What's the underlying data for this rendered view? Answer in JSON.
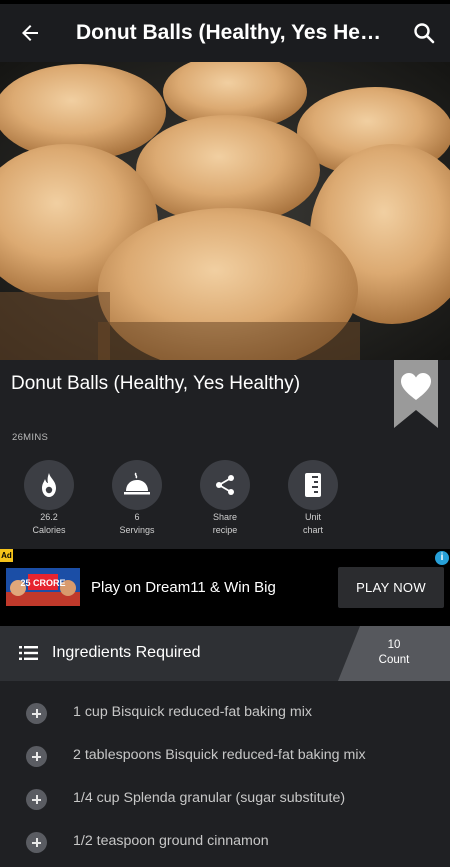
{
  "appbar": {
    "title": "Donut Balls (Healthy, Yes Healt...",
    "back_icon": "arrow-left-icon",
    "search_icon": "search-icon"
  },
  "recipe": {
    "title": "Donut Balls (Healthy, Yes Healthy)",
    "time": "26MINS",
    "favorite_icon": "heart-icon"
  },
  "stats": [
    {
      "icon": "fire-icon",
      "value": "26.2",
      "label": "Calories"
    },
    {
      "icon": "serving-dish-icon",
      "value": "6",
      "label": "Servings"
    },
    {
      "icon": "share-icon",
      "value": "Share",
      "label": "recipe"
    },
    {
      "icon": "unit-chart-icon",
      "value": "Unit",
      "label": "chart"
    }
  ],
  "ad": {
    "badge": "Ad",
    "thumb_text": "25 CRORE",
    "headline": "Play on Dream11 & Win Big",
    "cta": "PLAY NOW"
  },
  "ingredients": {
    "header": "Ingredients Required",
    "count": "10",
    "count_label": "Count",
    "items": [
      "1 cup Bisquick reduced-fat baking mix",
      "2 tablespoons Bisquick reduced-fat baking mix",
      "1/4 cup Splenda granular (sugar substitute)",
      "1/2 teaspoon ground cinnamon"
    ]
  },
  "colors": {
    "background": "#1f2023",
    "appbar": "#1b1c1f",
    "stat_circle": "#3c3e44",
    "ingredient_header": "#2e3034"
  }
}
